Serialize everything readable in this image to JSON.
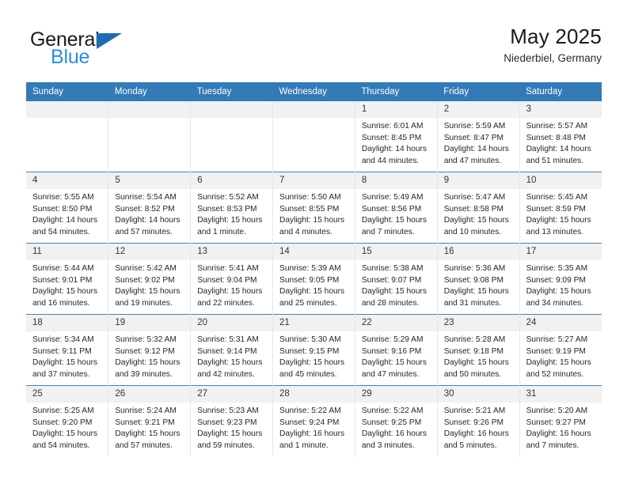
{
  "brand": {
    "name_part1": "General",
    "name_part2": "Blue",
    "triangle_icon": "blue-triangle-logo-mark",
    "colors": {
      "dark": "#1a1a1a",
      "blue": "#2e8bd4",
      "triangle": "#1f6cb0"
    }
  },
  "header": {
    "title": "May 2025",
    "subtitle": "Niederbiel, Germany"
  },
  "colors": {
    "header_blue": "#337ab7",
    "week_separator": "#4a81b4",
    "daynum_strip": "#f1f1f1",
    "cell_background": "#ffffff",
    "text": "#262626"
  },
  "calendar": {
    "weekday_headers": [
      "Sunday",
      "Monday",
      "Tuesday",
      "Wednesday",
      "Thursday",
      "Friday",
      "Saturday"
    ],
    "weeks": [
      [
        {
          "day": "",
          "lines": []
        },
        {
          "day": "",
          "lines": []
        },
        {
          "day": "",
          "lines": []
        },
        {
          "day": "",
          "lines": []
        },
        {
          "day": "1",
          "lines": [
            "Sunrise: 6:01 AM",
            "Sunset: 8:45 PM",
            "Daylight: 14 hours",
            "and 44 minutes."
          ]
        },
        {
          "day": "2",
          "lines": [
            "Sunrise: 5:59 AM",
            "Sunset: 8:47 PM",
            "Daylight: 14 hours",
            "and 47 minutes."
          ]
        },
        {
          "day": "3",
          "lines": [
            "Sunrise: 5:57 AM",
            "Sunset: 8:48 PM",
            "Daylight: 14 hours",
            "and 51 minutes."
          ]
        }
      ],
      [
        {
          "day": "4",
          "lines": [
            "Sunrise: 5:55 AM",
            "Sunset: 8:50 PM",
            "Daylight: 14 hours",
            "and 54 minutes."
          ]
        },
        {
          "day": "5",
          "lines": [
            "Sunrise: 5:54 AM",
            "Sunset: 8:52 PM",
            "Daylight: 14 hours",
            "and 57 minutes."
          ]
        },
        {
          "day": "6",
          "lines": [
            "Sunrise: 5:52 AM",
            "Sunset: 8:53 PM",
            "Daylight: 15 hours",
            "and 1 minute."
          ]
        },
        {
          "day": "7",
          "lines": [
            "Sunrise: 5:50 AM",
            "Sunset: 8:55 PM",
            "Daylight: 15 hours",
            "and 4 minutes."
          ]
        },
        {
          "day": "8",
          "lines": [
            "Sunrise: 5:49 AM",
            "Sunset: 8:56 PM",
            "Daylight: 15 hours",
            "and 7 minutes."
          ]
        },
        {
          "day": "9",
          "lines": [
            "Sunrise: 5:47 AM",
            "Sunset: 8:58 PM",
            "Daylight: 15 hours",
            "and 10 minutes."
          ]
        },
        {
          "day": "10",
          "lines": [
            "Sunrise: 5:45 AM",
            "Sunset: 8:59 PM",
            "Daylight: 15 hours",
            "and 13 minutes."
          ]
        }
      ],
      [
        {
          "day": "11",
          "lines": [
            "Sunrise: 5:44 AM",
            "Sunset: 9:01 PM",
            "Daylight: 15 hours",
            "and 16 minutes."
          ]
        },
        {
          "day": "12",
          "lines": [
            "Sunrise: 5:42 AM",
            "Sunset: 9:02 PM",
            "Daylight: 15 hours",
            "and 19 minutes."
          ]
        },
        {
          "day": "13",
          "lines": [
            "Sunrise: 5:41 AM",
            "Sunset: 9:04 PM",
            "Daylight: 15 hours",
            "and 22 minutes."
          ]
        },
        {
          "day": "14",
          "lines": [
            "Sunrise: 5:39 AM",
            "Sunset: 9:05 PM",
            "Daylight: 15 hours",
            "and 25 minutes."
          ]
        },
        {
          "day": "15",
          "lines": [
            "Sunrise: 5:38 AM",
            "Sunset: 9:07 PM",
            "Daylight: 15 hours",
            "and 28 minutes."
          ]
        },
        {
          "day": "16",
          "lines": [
            "Sunrise: 5:36 AM",
            "Sunset: 9:08 PM",
            "Daylight: 15 hours",
            "and 31 minutes."
          ]
        },
        {
          "day": "17",
          "lines": [
            "Sunrise: 5:35 AM",
            "Sunset: 9:09 PM",
            "Daylight: 15 hours",
            "and 34 minutes."
          ]
        }
      ],
      [
        {
          "day": "18",
          "lines": [
            "Sunrise: 5:34 AM",
            "Sunset: 9:11 PM",
            "Daylight: 15 hours",
            "and 37 minutes."
          ]
        },
        {
          "day": "19",
          "lines": [
            "Sunrise: 5:32 AM",
            "Sunset: 9:12 PM",
            "Daylight: 15 hours",
            "and 39 minutes."
          ]
        },
        {
          "day": "20",
          "lines": [
            "Sunrise: 5:31 AM",
            "Sunset: 9:14 PM",
            "Daylight: 15 hours",
            "and 42 minutes."
          ]
        },
        {
          "day": "21",
          "lines": [
            "Sunrise: 5:30 AM",
            "Sunset: 9:15 PM",
            "Daylight: 15 hours",
            "and 45 minutes."
          ]
        },
        {
          "day": "22",
          "lines": [
            "Sunrise: 5:29 AM",
            "Sunset: 9:16 PM",
            "Daylight: 15 hours",
            "and 47 minutes."
          ]
        },
        {
          "day": "23",
          "lines": [
            "Sunrise: 5:28 AM",
            "Sunset: 9:18 PM",
            "Daylight: 15 hours",
            "and 50 minutes."
          ]
        },
        {
          "day": "24",
          "lines": [
            "Sunrise: 5:27 AM",
            "Sunset: 9:19 PM",
            "Daylight: 15 hours",
            "and 52 minutes."
          ]
        }
      ],
      [
        {
          "day": "25",
          "lines": [
            "Sunrise: 5:25 AM",
            "Sunset: 9:20 PM",
            "Daylight: 15 hours",
            "and 54 minutes."
          ]
        },
        {
          "day": "26",
          "lines": [
            "Sunrise: 5:24 AM",
            "Sunset: 9:21 PM",
            "Daylight: 15 hours",
            "and 57 minutes."
          ]
        },
        {
          "day": "27",
          "lines": [
            "Sunrise: 5:23 AM",
            "Sunset: 9:23 PM",
            "Daylight: 15 hours",
            "and 59 minutes."
          ]
        },
        {
          "day": "28",
          "lines": [
            "Sunrise: 5:22 AM",
            "Sunset: 9:24 PM",
            "Daylight: 16 hours",
            "and 1 minute."
          ]
        },
        {
          "day": "29",
          "lines": [
            "Sunrise: 5:22 AM",
            "Sunset: 9:25 PM",
            "Daylight: 16 hours",
            "and 3 minutes."
          ]
        },
        {
          "day": "30",
          "lines": [
            "Sunrise: 5:21 AM",
            "Sunset: 9:26 PM",
            "Daylight: 16 hours",
            "and 5 minutes."
          ]
        },
        {
          "day": "31",
          "lines": [
            "Sunrise: 5:20 AM",
            "Sunset: 9:27 PM",
            "Daylight: 16 hours",
            "and 7 minutes."
          ]
        }
      ]
    ]
  }
}
